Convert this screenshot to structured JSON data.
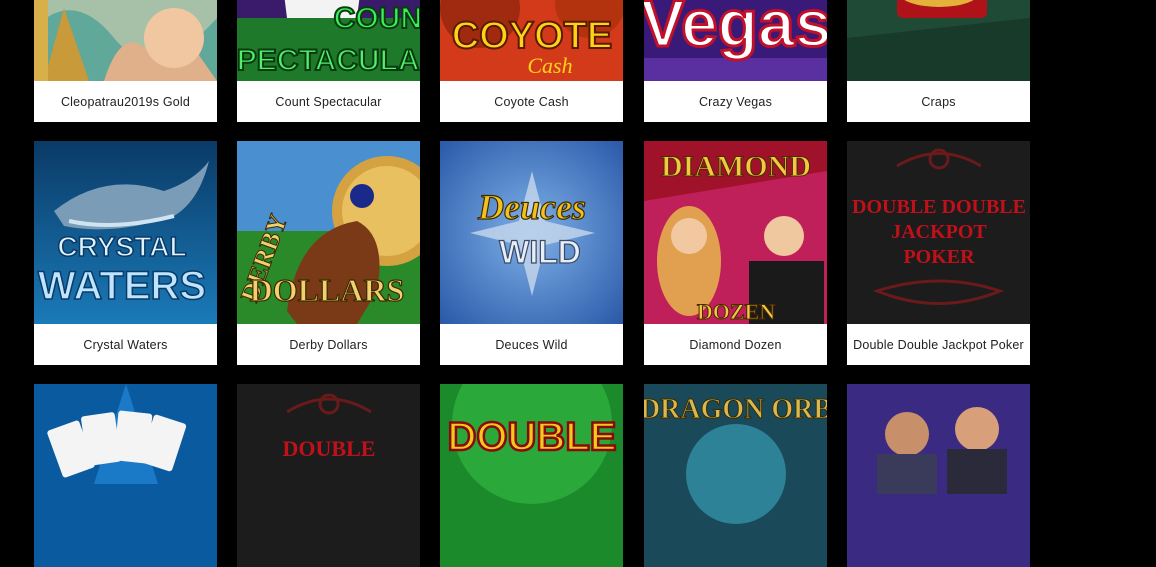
{
  "games": [
    {
      "title": "Cleopatrau2019s Gold",
      "art_text": ""
    },
    {
      "title": "Count Spectacular",
      "art_text": "COUNT SPECTACULAR"
    },
    {
      "title": "Coyote Cash",
      "art_text": "COYOTE CASH"
    },
    {
      "title": "Crazy Vegas",
      "art_text": "Vegas"
    },
    {
      "title": "Craps",
      "art_text": ""
    },
    {
      "title": "Crystal Waters",
      "art_text": "CRYSTAL WATERS"
    },
    {
      "title": "Derby Dollars",
      "art_text": "DERBY DOLLARS"
    },
    {
      "title": "Deuces Wild",
      "art_text": "Deuces WILD"
    },
    {
      "title": "Diamond Dozen",
      "art_text": "DIAMOND DOZEN"
    },
    {
      "title": "Double Double Jackpot Poker",
      "art_text": "DOUBLE DOUBLE JACKPOT POKER"
    },
    {
      "title": "",
      "art_text": ""
    },
    {
      "title": "",
      "art_text": "DOUBLE"
    },
    {
      "title": "",
      "art_text": "DOUBLE"
    },
    {
      "title": "",
      "art_text": "DRAGON ORB"
    },
    {
      "title": "",
      "art_text": ""
    }
  ]
}
